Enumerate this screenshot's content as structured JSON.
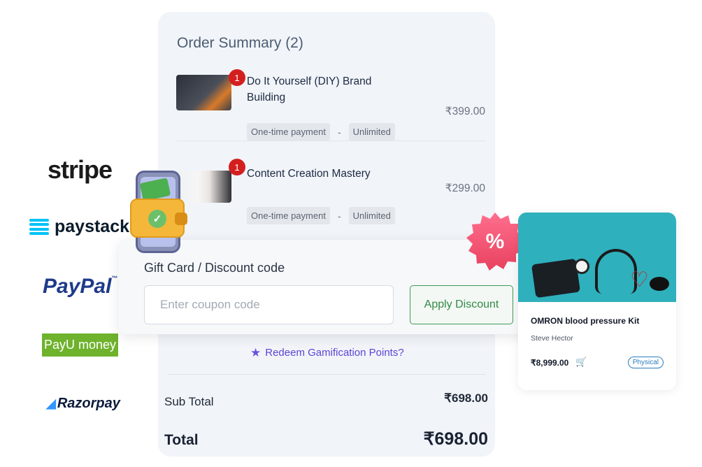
{
  "logos": {
    "stripe": "stripe",
    "paystack": "paystack",
    "paypal": "PayPal",
    "paypal_tm": "™",
    "payumoney": "PayU money",
    "razorpay": "Razorpay"
  },
  "order_summary": {
    "title": "Order Summary (2)",
    "items": [
      {
        "name": "Do It Yourself (DIY) Brand Building",
        "quantity": "1",
        "price": "₹399.00",
        "payment_type": "One-time payment",
        "separator": "-",
        "access": "Unlimited"
      },
      {
        "name": "Content Creation Mastery",
        "quantity": "1",
        "price": "₹299.00",
        "payment_type": "One-time payment",
        "separator": "-",
        "access": "Unlimited"
      }
    ],
    "redeem_link": "Redeem Gamification Points?",
    "subtotal_label": "Sub Total",
    "subtotal_value": "₹698.00",
    "total_label": "Total",
    "total_value": "₹698.00"
  },
  "discount": {
    "title": "Gift Card / Discount code",
    "input_placeholder": "Enter coupon code",
    "input_value": "",
    "apply_label": "Apply Discount"
  },
  "percent_badge": {
    "symbol": "%"
  },
  "product_card": {
    "name": "OMRON blood pressure Kit",
    "author": "Steve Hector",
    "price": "₹8,999.00",
    "badge": "Physical"
  },
  "colors": {
    "card_bg": "#f1f4f8",
    "accent_green": "#3f9b55",
    "badge_red": "#d41f1f",
    "redeem_purple": "#5a45d6",
    "product_teal": "#2fb0bd"
  }
}
